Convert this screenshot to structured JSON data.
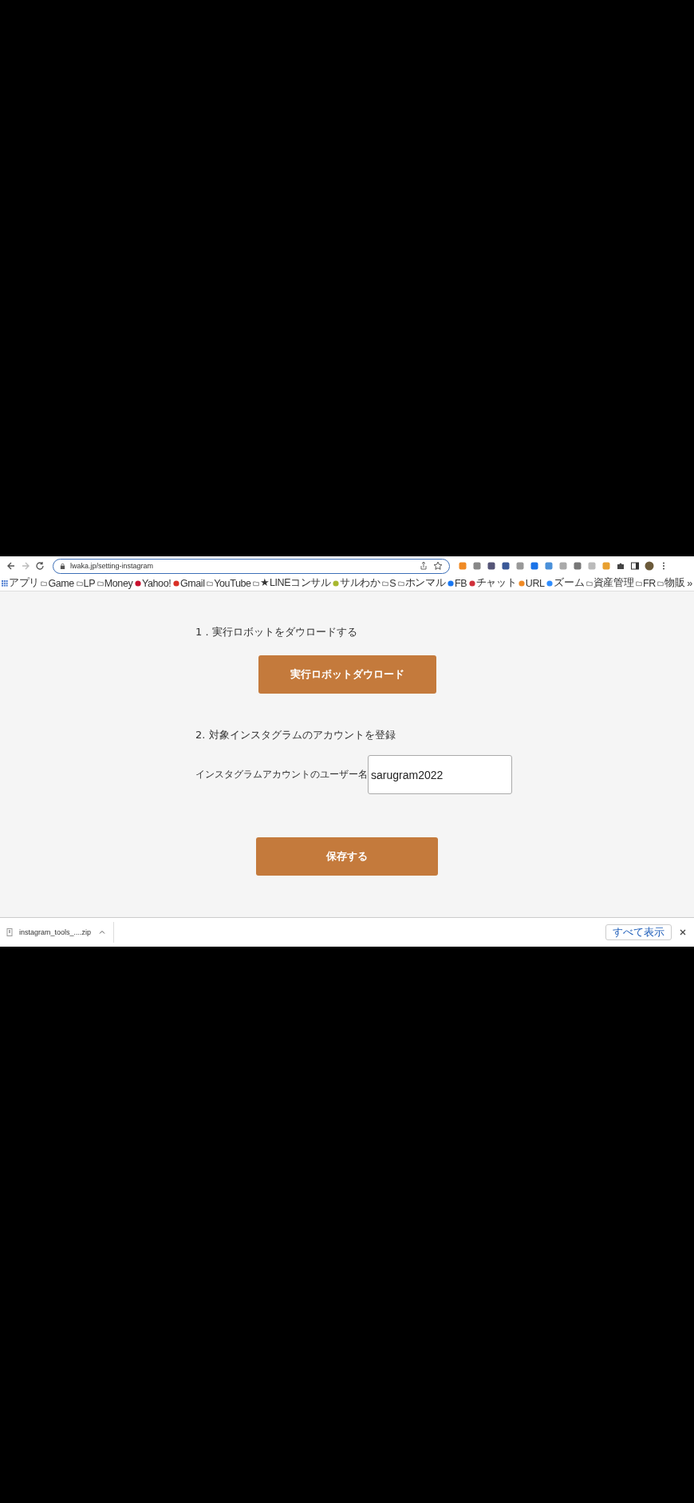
{
  "toolbar": {
    "url": "lwaka.jp/setting-instagram"
  },
  "bookmarks": [
    {
      "kind": "apps",
      "label": "アプリ"
    },
    {
      "kind": "folder",
      "label": "Game"
    },
    {
      "kind": "folder",
      "label": "LP"
    },
    {
      "kind": "folder",
      "label": "Money"
    },
    {
      "kind": "site",
      "label": "Yahoo!",
      "color": "#c8102e"
    },
    {
      "kind": "site",
      "label": "Gmail",
      "color": "#d93025"
    },
    {
      "kind": "folder",
      "label": "YouTube"
    },
    {
      "kind": "folder",
      "label": "★LINEコンサル"
    },
    {
      "kind": "site",
      "label": "サルわか",
      "color": "#a8b830"
    },
    {
      "kind": "folder",
      "label": "S"
    },
    {
      "kind": "folder",
      "label": "ホンマル"
    },
    {
      "kind": "site",
      "label": "FB",
      "color": "#1877f2"
    },
    {
      "kind": "site",
      "label": "チャット",
      "color": "#d0303a"
    },
    {
      "kind": "site",
      "label": "URL",
      "color": "#f08a24"
    },
    {
      "kind": "site",
      "label": "ズーム",
      "color": "#2d8cff"
    },
    {
      "kind": "folder",
      "label": "資産管理"
    },
    {
      "kind": "folder",
      "label": "FR"
    },
    {
      "kind": "folder",
      "label": "物販"
    }
  ],
  "bookmarks_more": "»",
  "page": {
    "step1": "1．実行ロボットをダウロードする",
    "download_button": "実行ロボットダウロード",
    "step2": "2. 対象インスタグラムのアカウントを登録",
    "username_label": "インスタグラムアカウントのユーザー名",
    "username_value": "sarugram2022",
    "save_button": "保存する"
  },
  "download_bar": {
    "file": "instagram_tools_....zip",
    "show_all": "すべて表示"
  }
}
